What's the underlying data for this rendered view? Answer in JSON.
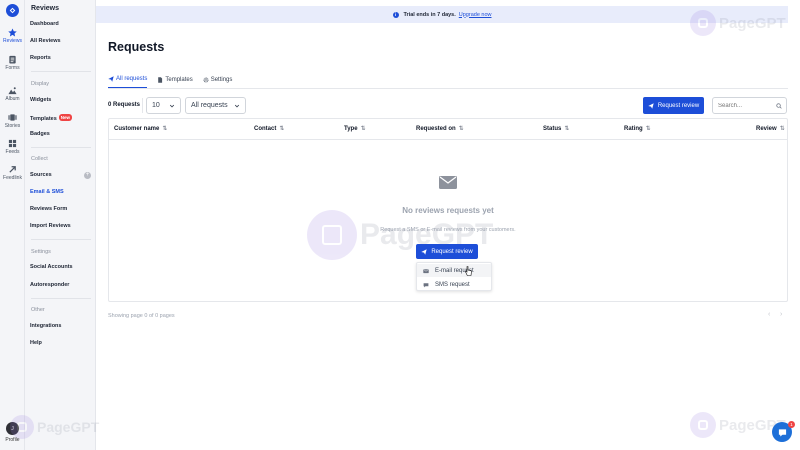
{
  "app": {
    "title": "Reviews"
  },
  "rail": {
    "items": [
      {
        "label": "Reviews",
        "icon": "star-icon"
      },
      {
        "label": "Forms",
        "icon": "clipboard-icon"
      },
      {
        "label": "Album",
        "icon": "image-icon"
      },
      {
        "label": "Stories",
        "icon": "stories-icon"
      },
      {
        "label": "Feeds",
        "icon": "grid-icon"
      },
      {
        "label": "Feedlink",
        "icon": "link-icon"
      }
    ],
    "profile": {
      "initial": "J",
      "label": "Profile"
    }
  },
  "submenu": {
    "title": "Reviews",
    "top_items": [
      "Dashboard",
      "All Reviews",
      "Reports"
    ],
    "display": {
      "heading": "Display",
      "items": [
        "Widgets",
        "Templates",
        "Badges"
      ],
      "new_badge": "New"
    },
    "collect": {
      "heading": "Collect",
      "items": [
        "Sources",
        "Email & SMS",
        "Reviews Form",
        "Import Reviews"
      ],
      "sources_add": "+"
    },
    "settings": {
      "heading": "Settings",
      "items": [
        "Social Accounts",
        "Autoresponder"
      ]
    },
    "other": {
      "heading": "Other",
      "items": [
        "Integrations",
        "Help"
      ]
    }
  },
  "trial": {
    "icon": "info-icon",
    "text": "Trial ends in 7 days.",
    "link": "Upgrade now"
  },
  "page": {
    "title": "Requests"
  },
  "tabs": [
    {
      "label": "All requests",
      "icon": "send-icon",
      "active": true
    },
    {
      "label": "Templates",
      "icon": "document-icon",
      "active": false
    },
    {
      "label": "Settings",
      "icon": "gear-icon",
      "active": false
    }
  ],
  "toolbar": {
    "count": "0 Requests",
    "per_page": "10",
    "filter": "All requests",
    "request_button": "Request review",
    "search_placeholder": "Search..."
  },
  "table": {
    "columns": [
      "Customer name",
      "Contact",
      "Type",
      "Requested on",
      "Status",
      "Rating",
      "Review"
    ],
    "sort_icon": "⇅"
  },
  "empty": {
    "title": "No reviews requests yet",
    "subtitle": "Request a SMS or E-mail reviews from your customers.",
    "button": "Request review"
  },
  "dropdown": {
    "items": [
      "E-mail request",
      "SMS request"
    ]
  },
  "pagination": {
    "text": "Showing page 0 of 0 pages",
    "prev": "‹",
    "next": "›"
  },
  "watermark": {
    "text": "PageGPT"
  },
  "chat": {
    "badge": "1"
  },
  "colors": {
    "accent": "#1d4ed8",
    "trial_bg": "#e8ecfb",
    "sidebar_bg": "#f4f5f8",
    "danger": "#ef4444"
  }
}
